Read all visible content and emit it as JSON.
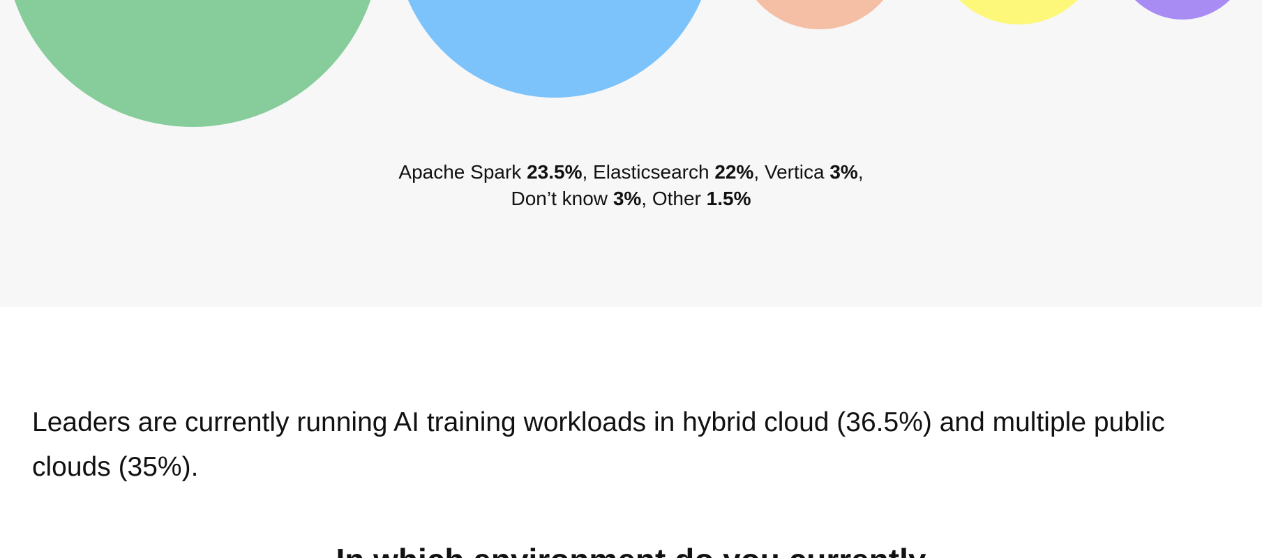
{
  "chart_data": {
    "type": "bubble",
    "series": [
      {
        "name": "Apache Spark",
        "value": 23.5,
        "color": "#86cd9b"
      },
      {
        "name": "Elasticsearch",
        "value": 22,
        "color": "#7cc2fb"
      },
      {
        "name": "Vertica",
        "value": 3,
        "color": "#f5bfa6"
      },
      {
        "name": "Don’t know",
        "value": 3,
        "color": "#fdf77a"
      },
      {
        "name": "Other",
        "value": 1.5,
        "color": "#a98cf3"
      }
    ],
    "unit": "%",
    "legend_placement": "bottom-center"
  },
  "legend_items": [
    {
      "label": "Apache Spark",
      "value": "23.5%",
      "sep": ", "
    },
    {
      "label": "Elasticsearch",
      "value": "22%",
      "sep": ", "
    },
    {
      "label": "Vertica",
      "value": "3%",
      "sep": ","
    },
    {
      "label": "Don’t know",
      "value": "3%",
      "sep": ", "
    },
    {
      "label": "Other",
      "value": "1.5%",
      "sep": ""
    }
  ],
  "finding": {
    "text": "Leaders are currently running AI training workloads in hybrid cloud (36.5%) and multiple public clouds (35%)."
  },
  "next_question": {
    "text": "In which environment do you currently"
  }
}
